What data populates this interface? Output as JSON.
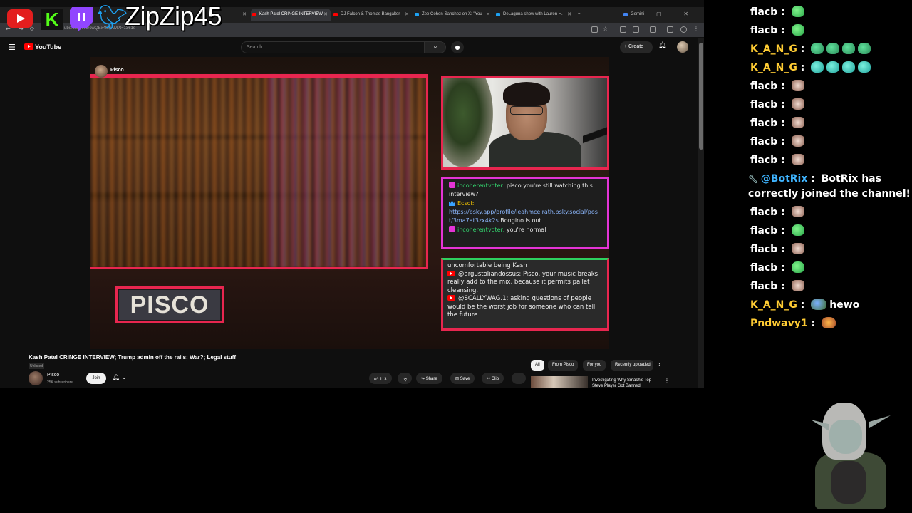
{
  "overlay": {
    "handle": "ZipZip45"
  },
  "browser": {
    "tabs": [
      {
        "label": "...",
        "fav": "#c0392b"
      },
      {
        "label": "...",
        "fav": "#c0392b"
      },
      {
        "label": "Kash Patel CRINGE INTERVIEW:",
        "fav": "#ff0000",
        "active": true
      },
      {
        "label": "DJ Falcon & Thomas Bangalter",
        "fav": "#ff0000"
      },
      {
        "label": "Zee Cohen-Sanchez on X: \"You",
        "fav": "#1da1f2"
      },
      {
        "label": "DeLaguna show with Lauren H.",
        "fav": "#1da1f2"
      },
      {
        "label": "Gemini",
        "fav": "#4285f4"
      }
    ],
    "url": "ube.com/live/owQEx4ts6AM?t=1361s"
  },
  "youtube": {
    "brand": "YouTube",
    "search_placeholder": "Search",
    "create_label": "Create"
  },
  "video": {
    "channel_chip": "Pisco",
    "badge": "PISCO",
    "chat_top": [
      {
        "type": "heart",
        "user": "incoherentvoter:",
        "text": "pisco you're still watching this interview?"
      },
      {
        "type": "crown",
        "user": "Ecsol:",
        "link": "https://bsky.app/profile/leahmcelrath.bsky.social/post/3ma7at3zx4k2s",
        "text": "Bongino is out"
      },
      {
        "type": "heart",
        "user": "incoherentvoter:",
        "text": "you're normal"
      }
    ],
    "chat_bottom": {
      "partial": "uncomfortable being Kash",
      "messages": [
        {
          "user": "@argustoliandossus:",
          "text": "Pisco, your music breaks really add to the mix, because it permits pallet cleansing."
        },
        {
          "user": "@SCALLYWAG.1:",
          "text": "asking questions of people would be the worst job for someone who can tell the future"
        }
      ]
    }
  },
  "below": {
    "title": "Kash Patel CRINGE INTERVIEW; Trump admin off the rails; War?; Legal stuff",
    "unlisted": "Unlisted",
    "channel": "Pisco",
    "subs": "25K subscribers",
    "join": "Join",
    "likes": "113",
    "share": "Share",
    "save": "Save",
    "clip": "Clip",
    "more": "···",
    "chips": [
      "All",
      "From Pisco",
      "For you",
      "Recently uploaded"
    ],
    "rec_title": "Investigating Why Smash's Top Steve Player Got Banned"
  },
  "chat": [
    {
      "user": "flacb",
      "emotes": [
        "green"
      ]
    },
    {
      "user": "flacb",
      "emotes": [
        "green"
      ]
    },
    {
      "user": "K_A_N_G",
      "emotes": [
        "pepe",
        "pepe",
        "pepe",
        "pepe"
      ]
    },
    {
      "user": "K_A_N_G",
      "emotes": [
        "teal",
        "teal",
        "teal",
        "teal"
      ]
    },
    {
      "user": "flacb",
      "emotes": [
        "cat"
      ]
    },
    {
      "user": "flacb",
      "emotes": [
        "cat"
      ]
    },
    {
      "user": "flacb",
      "emotes": [
        "cat"
      ]
    },
    {
      "user": "flacb",
      "emotes": [
        "cat"
      ]
    },
    {
      "user": "flacb",
      "emotes": [
        "cat"
      ]
    },
    {
      "user": "@BotRix",
      "bot": true,
      "text": "BotRix has correctly joined the channel!"
    },
    {
      "user": "flacb",
      "emotes": [
        "cat"
      ]
    },
    {
      "user": "flacb",
      "emotes": [
        "green"
      ]
    },
    {
      "user": "flacb",
      "emotes": [
        "cat"
      ]
    },
    {
      "user": "flacb",
      "emotes": [
        "green"
      ]
    },
    {
      "user": "flacb",
      "emotes": [
        "cat"
      ]
    },
    {
      "user": "K_A_N_G",
      "emotes": [
        "hewo"
      ],
      "text": "hewo"
    },
    {
      "user": "Pndwavy1",
      "emotes": [
        "pnd"
      ]
    }
  ],
  "chat_separator": " : ",
  "colors": {
    "accent_red": "#e8264f",
    "accent_magenta": "#e434d6",
    "chat_green": "#2fd05f"
  }
}
